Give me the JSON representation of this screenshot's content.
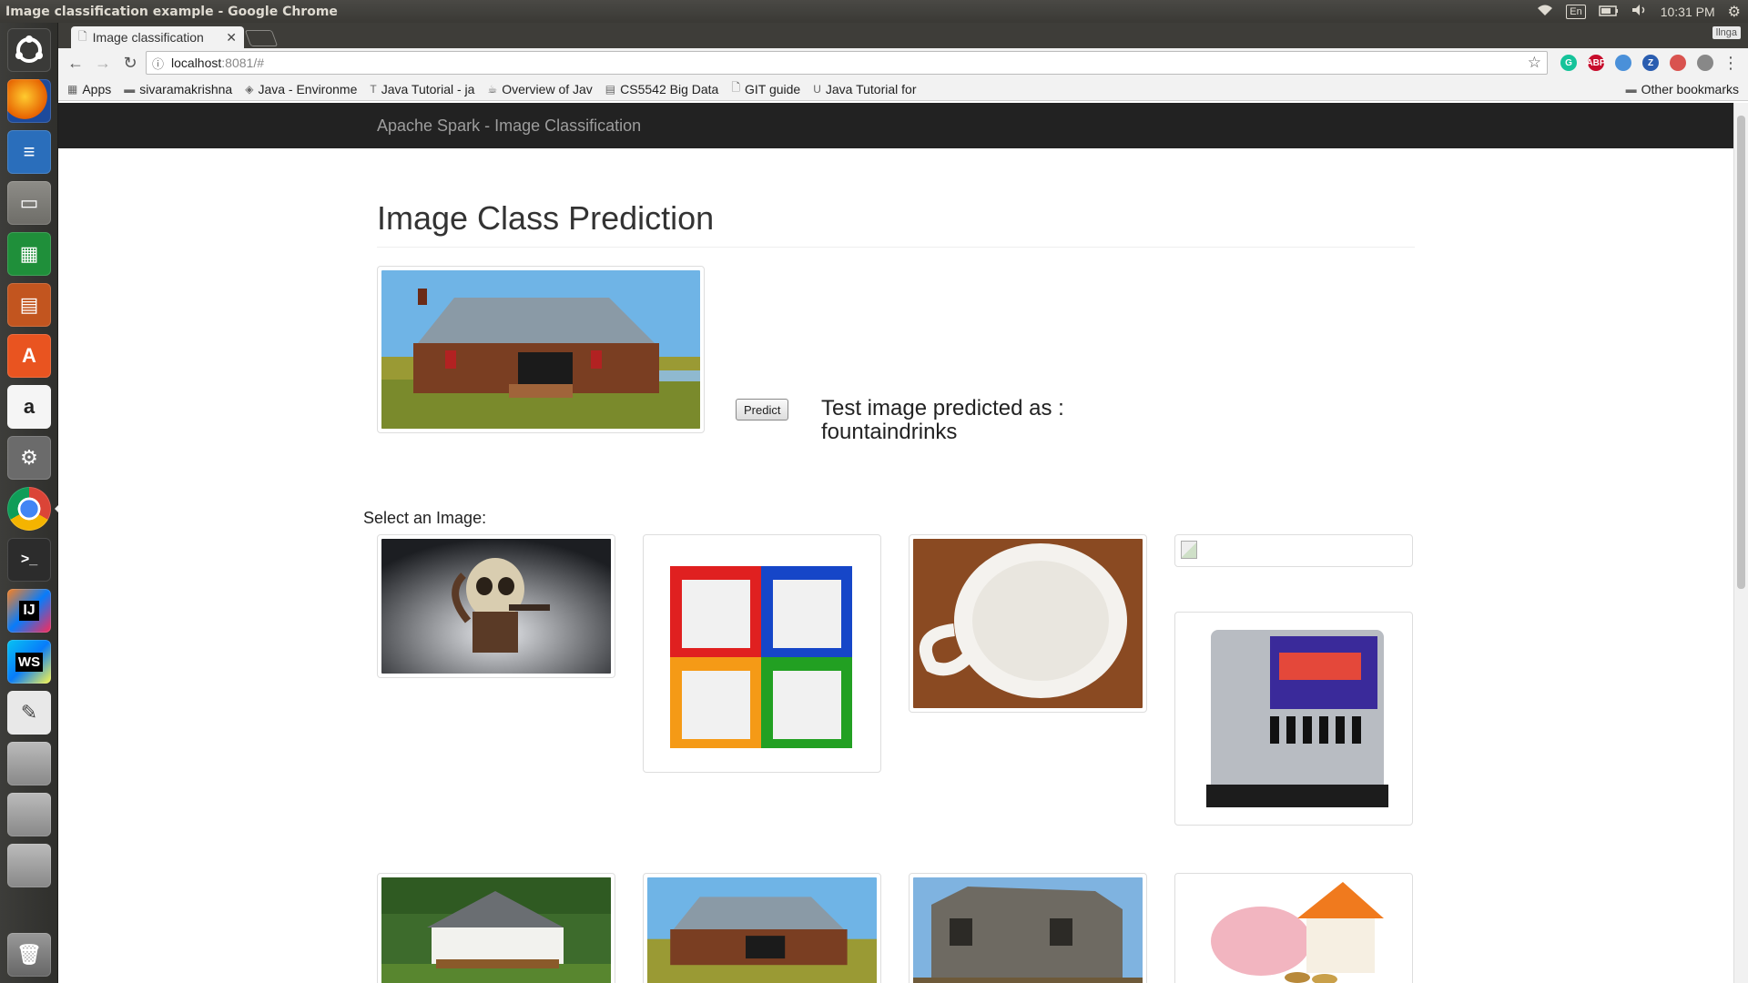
{
  "os_panel": {
    "window_title": "Image classification example - Google Chrome",
    "keyboard": "En",
    "clock": "10:31 PM"
  },
  "launcher": {
    "apps": [
      "ubuntu-dash",
      "firefox",
      "writer",
      "files",
      "calc",
      "impress",
      "software-center",
      "amazon",
      "system-settings",
      "chrome",
      "terminal",
      "intellij",
      "webstorm",
      "text-editor",
      "drive-1",
      "drive-2",
      "drive-3",
      "trash"
    ]
  },
  "browser": {
    "tab_title": "Image classification",
    "user_chip": "llnga",
    "url_host": "localhost",
    "url_rest": ":8081/#",
    "bookmarks": [
      {
        "label": "Apps",
        "icon": "grid-icon"
      },
      {
        "label": "sivaramakrishna",
        "icon": "folder-icon"
      },
      {
        "label": "Java - Environme",
        "icon": "diamond-icon"
      },
      {
        "label": "Java Tutorial - ja",
        "icon": "t-icon"
      },
      {
        "label": "Overview of Jav",
        "icon": "java-icon"
      },
      {
        "label": "CS5542 Big Data",
        "icon": "sheet-icon"
      },
      {
        "label": "GIT guide",
        "icon": "doc-icon"
      },
      {
        "label": "Java Tutorial for",
        "icon": "u-icon"
      }
    ],
    "other_bookmarks": "Other bookmarks",
    "extensions": [
      {
        "name": "grammarly-icon",
        "label": "G",
        "color": "#15c39a"
      },
      {
        "name": "adblock-icon",
        "label": "ABP",
        "color": "#c70d2c"
      },
      {
        "name": "extension-icon",
        "label": "",
        "color": "#4a90d9"
      },
      {
        "name": "zotero-icon",
        "label": "Z",
        "color": "#2a5db0"
      },
      {
        "name": "shield-icon",
        "label": "",
        "color": "#d9534f"
      },
      {
        "name": "cast-icon",
        "label": "",
        "color": "#888888"
      }
    ]
  },
  "app": {
    "brand": "Apache Spark - Image Classification",
    "page_title": "Image Class Prediction",
    "predict_button": "Predict",
    "prediction_prefix": "Test image predicted as :",
    "prediction_value": "fountaindrinks",
    "select_label": "Select an Image:",
    "gallery": [
      {
        "id": "skull-mug",
        "alt": ""
      },
      {
        "id": "cube-drawers",
        "alt": ""
      },
      {
        "id": "latte-cup",
        "alt": ""
      },
      {
        "id": "broken-image",
        "alt": ""
      },
      {
        "id": "soda-fountain",
        "alt": ""
      },
      {
        "id": "white-house",
        "alt": ""
      },
      {
        "id": "log-cabin",
        "alt": ""
      },
      {
        "id": "old-barn",
        "alt": ""
      },
      {
        "id": "piggy-house",
        "alt": ""
      }
    ]
  }
}
